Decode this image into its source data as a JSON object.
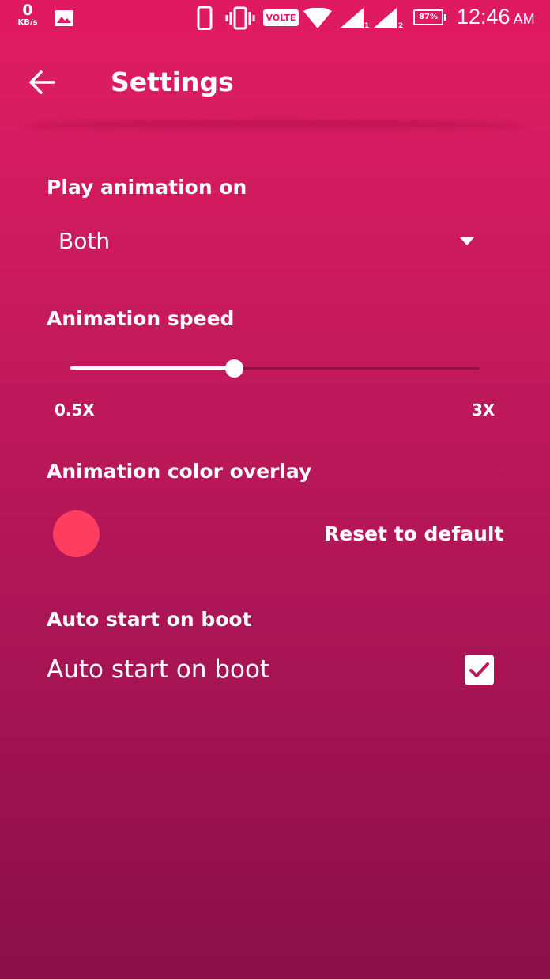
{
  "status_bar": {
    "net_speed_value": "0",
    "net_speed_unit": "KB/s",
    "volte": "VOLTE",
    "sim1": "1",
    "sim2": "2",
    "battery": "87%",
    "time": "12:46",
    "ampm": "AM",
    "icons": [
      "image-icon",
      "phone-icon",
      "vibrate-icon",
      "wifi-icon",
      "signal-icon",
      "battery-icon"
    ]
  },
  "app_bar": {
    "title": "Settings",
    "back_icon": "arrow-back-icon"
  },
  "play_animation": {
    "label": "Play animation on",
    "selected": "Both"
  },
  "animation_speed": {
    "label": "Animation speed",
    "min_label": "0.5X",
    "max_label": "3X",
    "value_fraction": 0.4
  },
  "color_overlay": {
    "label": "Animation color overlay",
    "swatch_color": "#ff3d5e",
    "reset_label": "Reset to default"
  },
  "auto_start": {
    "section_label": "Auto start on boot",
    "checkbox_label": "Auto start on boot",
    "checked": true
  },
  "theme": {
    "accent": "#e01a60"
  }
}
